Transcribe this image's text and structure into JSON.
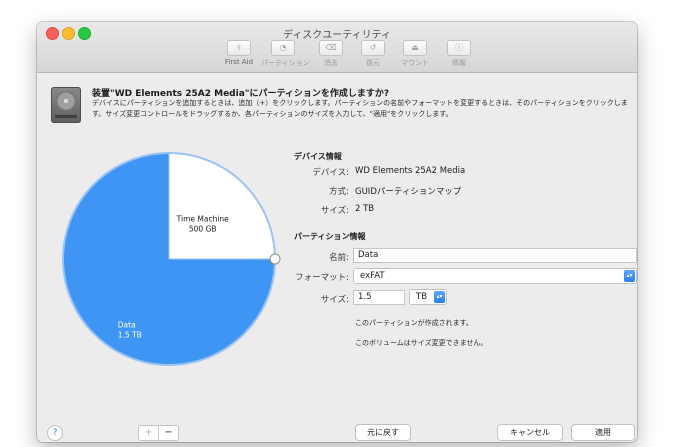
{
  "window": {
    "title": "ディスクユーティリティ"
  },
  "toolbar": {
    "items": [
      {
        "icon": "stethoscope-icon",
        "glyph": "⚕",
        "label": "First Aid"
      },
      {
        "icon": "partition-icon",
        "glyph": "◔",
        "label": "パーティション"
      },
      {
        "icon": "erase-icon",
        "glyph": "⌫",
        "label": "消去"
      },
      {
        "icon": "restore-icon",
        "glyph": "↺",
        "label": "復元"
      },
      {
        "icon": "mount-icon",
        "glyph": "⏏",
        "label": "マウント"
      },
      {
        "icon": "info-icon",
        "glyph": "ⓘ",
        "label": "情報"
      }
    ]
  },
  "sheet": {
    "title": "装置\"WD Elements 25A2 Media\"にパーティションを作成しますか?",
    "description": "デバイスにパーティションを追加するときは、追加（+）をクリックします。パーティションの名前やフォーマットを変更するときは、そのパーティションをクリックします。サイズ変更コントロールをドラッグするか、各パーティションのサイズを入力して、\"適用\"をクリックします。"
  },
  "pie": {
    "slices": [
      {
        "name": "Time Machine",
        "size": "500 GB",
        "fraction": 0.25,
        "color": "#ffffff"
      },
      {
        "name": "Data",
        "size": "1.5 TB",
        "fraction": 0.75,
        "color": "#3f95f3"
      }
    ]
  },
  "device_info": {
    "heading": "デバイス情報",
    "device_label": "デバイス:",
    "device_value": "WD Elements 25A2 Media",
    "scheme_label": "方式:",
    "scheme_value": "GUIDパーティションマップ",
    "size_label": "サイズ:",
    "size_value": "2 TB"
  },
  "partition_info": {
    "heading": "パーティション情報",
    "name_label": "名前:",
    "name_value": "Data",
    "format_label": "フォーマット:",
    "format_value": "exFAT",
    "size_label": "サイズ:",
    "size_value": "1.5",
    "unit_value": "TB",
    "note1": "このパーティションが作成されます。",
    "note2": "このボリュームはサイズ変更できません。"
  },
  "buttons": {
    "help": "?",
    "add": "+",
    "remove": "−",
    "revert": "元に戻す",
    "cancel": "キャンセル",
    "apply": "適用"
  },
  "colors": {
    "accent": "#2b7ff0",
    "pie_blue": "#3f95f3"
  }
}
